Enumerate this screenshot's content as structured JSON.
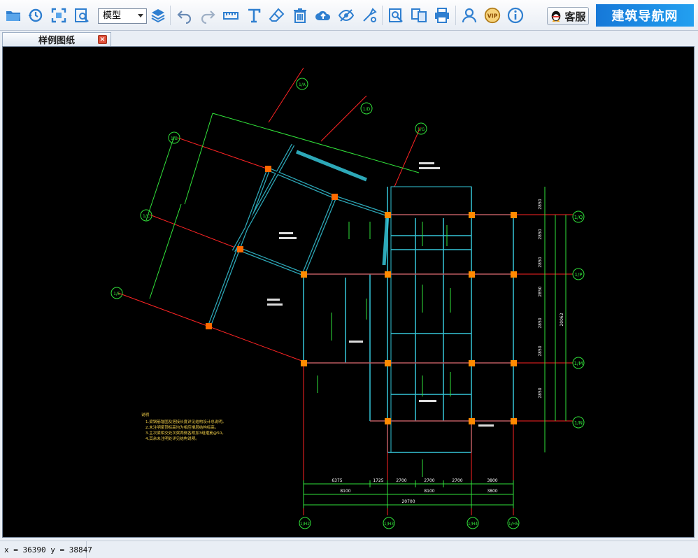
{
  "toolbar": {
    "icons": [
      "open-folder-icon",
      "history-icon",
      "fit-screen-icon",
      "zoom-window-icon",
      "layers-icon",
      "undo-icon",
      "redo-icon",
      "measure-icon",
      "text-icon",
      "eraser-icon",
      "delete-icon",
      "cloud-icon",
      "visibility-icon",
      "settings-icon",
      "find-icon",
      "compare-icon",
      "print-icon",
      "user-icon",
      "vip-icon",
      "info-icon"
    ],
    "view_mode": "模型",
    "vip_label": "VIP",
    "service_label": "客服",
    "brand_label": "建筑导航网",
    "accent_color": "#1a7fe0"
  },
  "tab": {
    "title": "样例图纸",
    "close_label": "×"
  },
  "drawing": {
    "axis_labels": {
      "right": [
        "1/Q",
        "1/P",
        "1/M",
        "1/N"
      ],
      "bottom": [
        "1/H2",
        "1/H3",
        "1/H4",
        "1/H5"
      ],
      "left": [
        "1/B",
        "1/C",
        "1/E"
      ],
      "top": [
        "1/A",
        "1/D",
        "1/G"
      ]
    },
    "dim_bottom_row1": [
      "6375",
      "1725",
      "2700",
      "2700",
      "2700",
      "3800"
    ],
    "dim_bottom_row2": [
      "8100",
      "8100",
      "3800"
    ],
    "dim_bottom_total": "20700",
    "dim_right_col": [
      "2850",
      "2850",
      "2850",
      "2850",
      "2850",
      "2850",
      "2850"
    ],
    "dim_right_total": "20062",
    "notes_title": "说明",
    "notes": [
      "1.梁钢筋锚固及搭接长度详见结构设计总说明。",
      "2.未注明梁顶标高均为相应楼层结构标高。",
      "3.主次梁相交处次梁两侧各附加3组箍筋@50。",
      "4.其余未注明处详见结构说明。"
    ],
    "colors": {
      "beam": "#35c6d8",
      "dim": "#31e23a",
      "axis": "#ff2424",
      "column": "#ffb020",
      "text": "#ffffff",
      "note": "#f3d04a"
    }
  },
  "status": {
    "coords": "x = 36390  y = 38847"
  }
}
